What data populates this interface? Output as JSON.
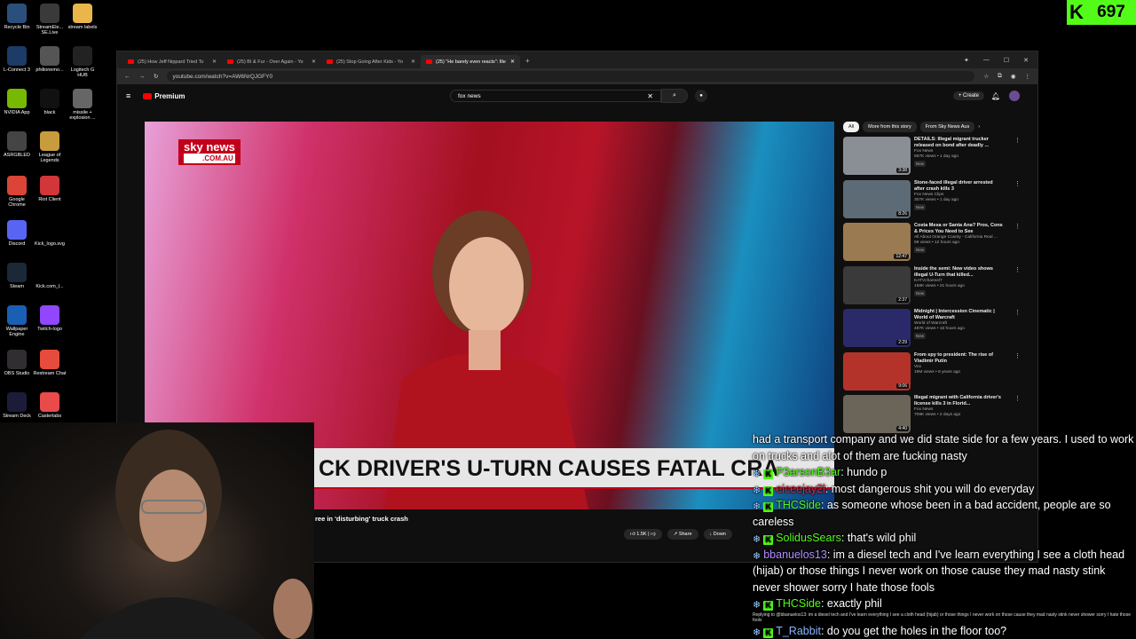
{
  "kick_counter": {
    "value": "697",
    "logo": "K"
  },
  "desktop_icons": [
    {
      "label": "Recycle Bin",
      "icon": "recycle-bin-icon",
      "color": "#2a4f7a"
    },
    {
      "label": "StreamEle... SE.Live",
      "icon": "streamelements-icon",
      "color": "#3a3a3a"
    },
    {
      "label": "stream labels",
      "icon": "folder-icon",
      "color": "#e8b64a"
    },
    {
      "label": "L-Connect 3",
      "icon": "lconnect-icon",
      "color": "#1c3b66"
    },
    {
      "label": "philionemo...",
      "icon": "user-icon",
      "color": "#555"
    },
    {
      "label": "Logitech G HUB",
      "icon": "logitech-icon",
      "color": "#222"
    },
    {
      "label": "NVIDIA App",
      "icon": "nvidia-icon",
      "color": "#76b900"
    },
    {
      "label": "black",
      "icon": "file-icon",
      "color": "#111"
    },
    {
      "label": "missile + explosion ...",
      "icon": "image-icon",
      "color": "#666"
    },
    {
      "label": "ASRGBLED",
      "icon": "asrock-icon",
      "color": "#444"
    },
    {
      "label": "League of Legends",
      "icon": "lol-icon",
      "color": "#c89b3c"
    },
    {
      "label": "Google Chrome",
      "icon": "chrome-icon",
      "color": "#db4437"
    },
    {
      "label": "Riot Client",
      "icon": "riot-icon",
      "color": "#d13639"
    },
    {
      "label": "Discord",
      "icon": "discord-icon",
      "color": "#5865f2"
    },
    {
      "label": "Kick_logo.svg",
      "icon": "kick-icon",
      "color": "#000"
    },
    {
      "label": "Steam",
      "icon": "steam-icon",
      "color": "#1b2838"
    },
    {
      "label": "Kick.com_l...",
      "icon": "kick-icon",
      "color": "#000"
    },
    {
      "label": "Wallpaper Engine",
      "icon": "wallpaper-engine-icon",
      "color": "#1a5fb4"
    },
    {
      "label": "Twitch-logo",
      "icon": "twitch-icon",
      "color": "#9146ff"
    },
    {
      "label": "OBS Studio",
      "icon": "obs-icon",
      "color": "#302e31"
    },
    {
      "label": "Restream Chat",
      "icon": "restream-icon",
      "color": "#e64b3c"
    },
    {
      "label": "Stream Deck",
      "icon": "stream-deck-icon",
      "color": "#1c1c3a"
    },
    {
      "label": "Casterlabs",
      "icon": "casterlabs-icon",
      "color": "#e94b4b"
    }
  ],
  "browser": {
    "tabs": [
      {
        "label": "(25) How Jeff Nippard Tried To"
      },
      {
        "label": "(25) BI & Fur - Over Again - Yo"
      },
      {
        "label": "(25) Stop Going After Kids - Yo"
      },
      {
        "label": "(25) \"He barely even reacts\": Ille"
      }
    ],
    "url": "youtube.com/watch?v=AW6NrQJGFY0"
  },
  "youtube": {
    "logo_text": "Premium",
    "search_value": "fox news",
    "create_label": "Create",
    "notification_count": "9+",
    "video": {
      "channel_logo": "sky",
      "channel_logo_text": "news",
      "channel_logo_sub": ".COM.AU",
      "lower_third": "CK DRIVER'S U-TURN CAUSES FATAL CRA",
      "title_fragment": "ree in 'disturbing' truck crash",
      "likes": "1.5K",
      "share_label": "Share",
      "download_label": "Down"
    },
    "chips": [
      {
        "label": "All",
        "selected": true
      },
      {
        "label": "More from this story",
        "selected": false
      },
      {
        "label": "From Sky News Aus",
        "selected": false
      }
    ],
    "related": [
      {
        "title": "DETAILS: Illegal migrant trucker released on bond after deadly ...",
        "channel": "Fox News",
        "meta": "667K views • 1 day ago",
        "badge": "New",
        "duration": "3:38",
        "color": "#8a8f96"
      },
      {
        "title": "Stone-faced illegal driver arrested after crash kills 3",
        "channel": "Fox News Clips",
        "meta": "307K views • 1 day ago",
        "badge": "New",
        "duration": "8:26",
        "color": "#5c6b76"
      },
      {
        "title": "Costa Mesa or Santa Ana? Pros, Cons & Prices You Need to See",
        "channel": "All About Orange County - California Real ...",
        "meta": "59 views • 12 hours ago",
        "badge": "New",
        "duration": "12:47",
        "color": "#9a7a50"
      },
      {
        "title": "Inside the semi: New video shows illegal U-Turn that killed...",
        "channel": "KATVchannel7",
        "meta": "158K views • 21 hours ago",
        "badge": "New",
        "duration": "2:37",
        "color": "#3a3a3a"
      },
      {
        "title": "Midnight | Intercession Cinematic | World of Warcraft",
        "channel": "World of Warcraft",
        "meta": "487K views • 16 hours ago",
        "badge": "New",
        "duration": "2:29",
        "color": "#2a2a6a"
      },
      {
        "title": "From spy to president: The rise of Vladimir Putin",
        "channel": "Vox",
        "meta": "19M views • 8 years ago",
        "badge": "",
        "duration": "9:06",
        "color": "#b3332b"
      },
      {
        "title": "Illegal migrant with California driver's license kills 3 in Florid...",
        "channel": "Fox News",
        "meta": "708K views • 2 days ago",
        "badge": "",
        "duration": "4:40",
        "color": "#6b6458"
      }
    ]
  },
  "chat": {
    "messages": [
      {
        "user": "",
        "text": "had a transport company and we did state side for a few years. I used to work on trucks and alot of them are fucking nasty",
        "color": "green",
        "badges": []
      },
      {
        "user": "P3arsonB3ar",
        "text": ": hundo p",
        "color": "green",
        "badges": [
          "snow",
          "k"
        ]
      },
      {
        "user": "eiceejay2l",
        "text": ": most dangerous shit you will do everyday",
        "color": "red",
        "badges": [
          "snow",
          "k"
        ]
      },
      {
        "user": "THCSide",
        "text": ": as someone whose been in a bad accident, people are so careless",
        "color": "green",
        "badges": [
          "snow",
          "k"
        ]
      },
      {
        "user": "SolidusSears",
        "text": ": that's wild phil",
        "color": "green",
        "badges": [
          "snow",
          "k"
        ]
      },
      {
        "user": "bbanuelos13",
        "text": ": im a diesel tech and I've learn everything I see a cloth head (hijab) or those things I never work on those cause they mad nasty stink never shower sorry I hate those fools",
        "color": "purple",
        "badges": [
          "snow"
        ]
      },
      {
        "user": "THCSide",
        "text": ": exactly phil",
        "color": "green",
        "badges": [
          "snow",
          "k"
        ]
      },
      {
        "user": "",
        "text": "Replying to @bbanuelos13: im a diesel tech and I've learn everything I see a cloth head (hijab) or those things I never work on those cause they mad nasty stink never shower sorry I hate those fools",
        "color": "reply",
        "badges": []
      },
      {
        "user": "T_Rabbit",
        "text": ": do you get the holes in the floor too?",
        "color": "blue",
        "badges": [
          "snow",
          "k"
        ]
      }
    ]
  }
}
